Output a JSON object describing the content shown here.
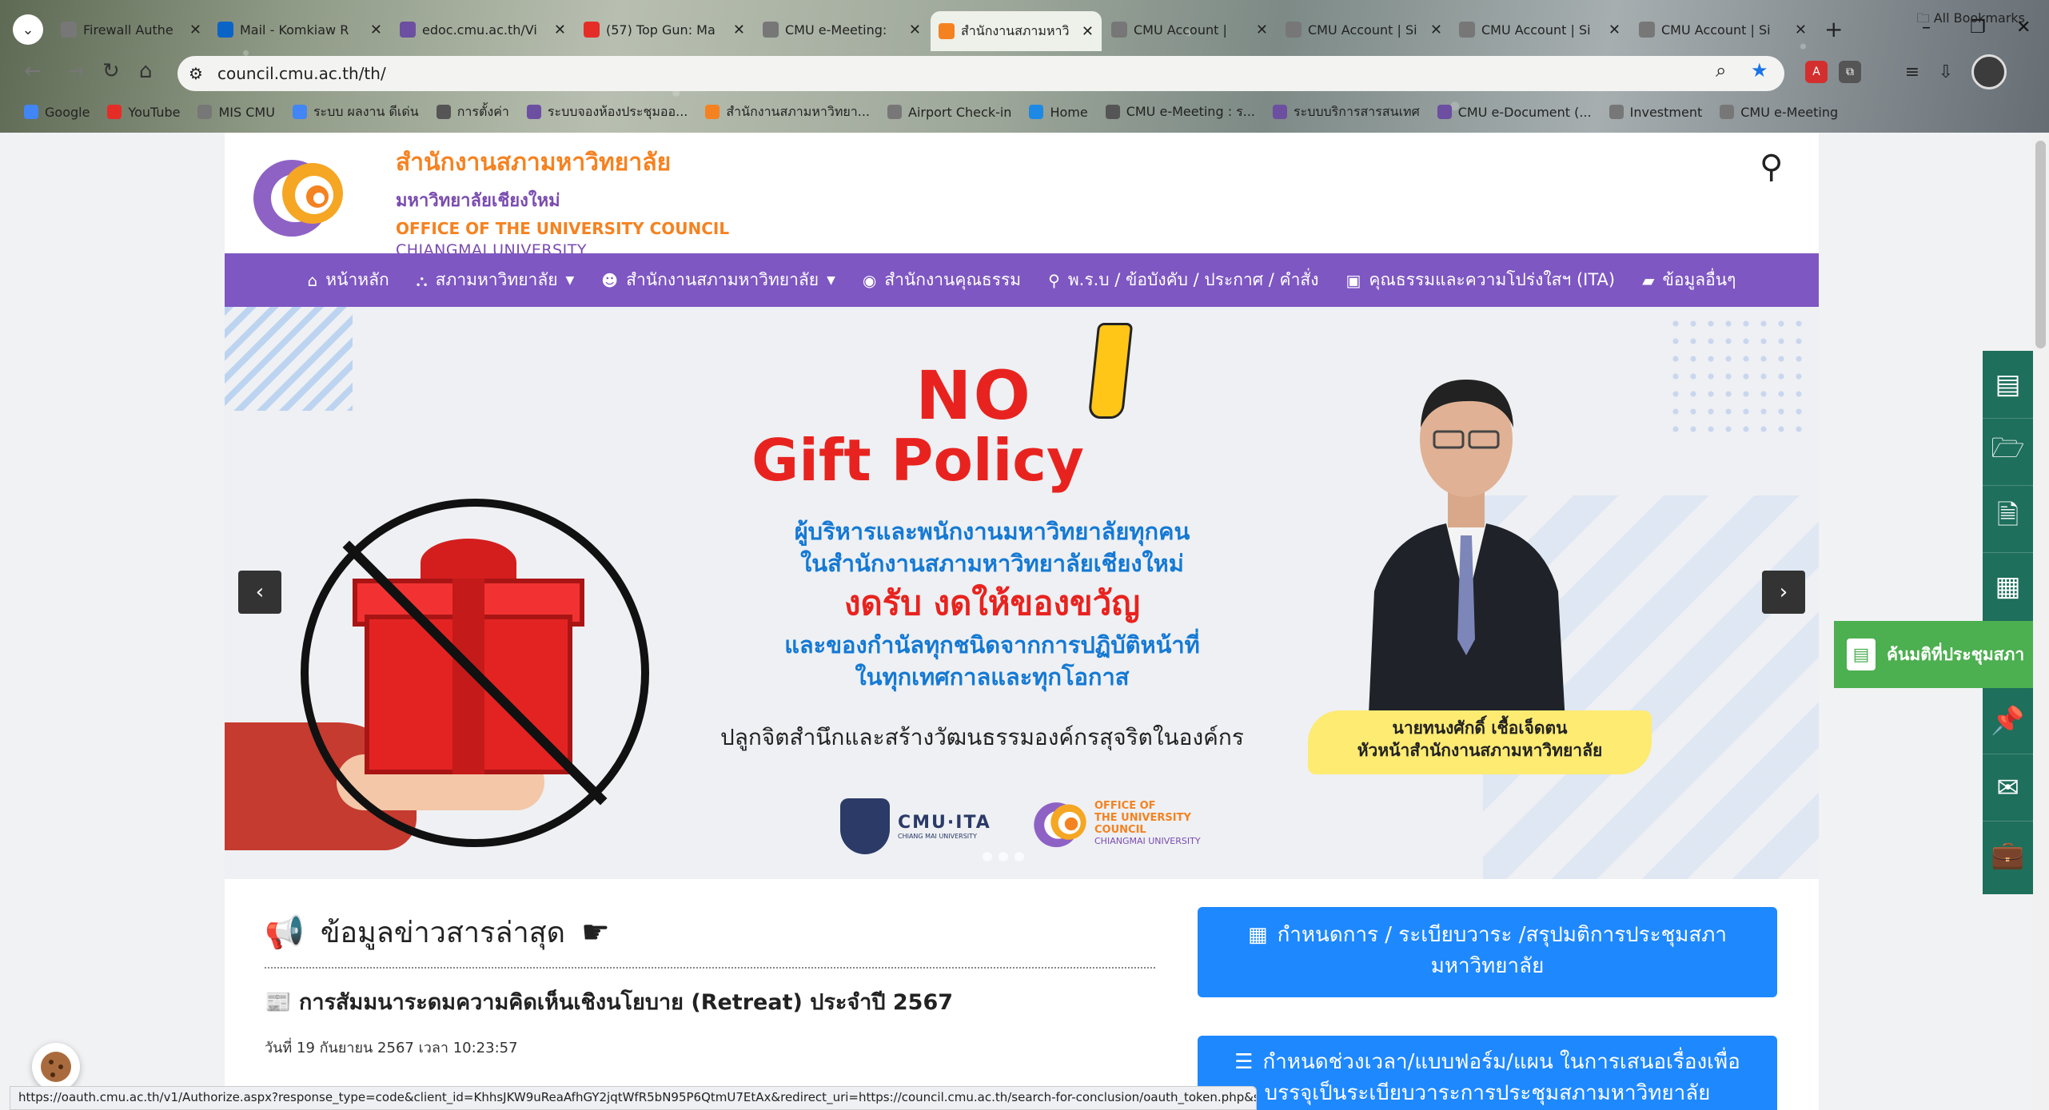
{
  "browser": {
    "tabs": [
      {
        "title": "Firewall Authe",
        "icon": "globe-icon",
        "color": "#777777"
      },
      {
        "title": "Mail - Komkiaw R",
        "icon": "outlook-icon",
        "color": "#0a64c8"
      },
      {
        "title": "edoc.cmu.ac.th/Vi",
        "icon": "cmu-icon",
        "color": "#6c4fa0"
      },
      {
        "title": "(57) Top Gun: Ma",
        "icon": "youtube-icon",
        "color": "#e52d27"
      },
      {
        "title": "CMU e-Meeting:",
        "icon": "globe-icon",
        "color": "#777777"
      },
      {
        "title": "สำนักงานสภามหาวิ",
        "icon": "council-icon",
        "color": "#f58220"
      },
      {
        "title": "CMU Account |",
        "icon": "globe-icon",
        "color": "#777777"
      },
      {
        "title": "CMU Account | Si",
        "icon": "globe-icon",
        "color": "#777777"
      },
      {
        "title": "CMU Account | Si",
        "icon": "globe-icon",
        "color": "#777777"
      },
      {
        "title": "CMU Account | Si",
        "icon": "globe-icon",
        "color": "#777777"
      }
    ],
    "url": "council.cmu.ac.th/th/",
    "bookmarks": [
      {
        "label": "Google",
        "color": "#4285f4"
      },
      {
        "label": "YouTube",
        "color": "#e52d27"
      },
      {
        "label": "MIS CMU",
        "color": "#777777"
      },
      {
        "label": "ระบบ ผลงาน ดีเด่น",
        "color": "#4285f4"
      },
      {
        "label": "การตั้งค่า",
        "color": "#555555"
      },
      {
        "label": "ระบบจองห้องประชุมออ...",
        "color": "#6c4fa0"
      },
      {
        "label": "สำนักงานสภามหาวิทยา...",
        "color": "#f58220"
      },
      {
        "label": "Airport Check-in",
        "color": "#777777"
      },
      {
        "label": "Home",
        "color": "#1e88e5"
      },
      {
        "label": "CMU e-Meeting : ร...",
        "color": "#555555"
      },
      {
        "label": "ระบบบริการสารสนเทศ",
        "color": "#6c4fa0"
      },
      {
        "label": "CMU e-Document (...",
        "color": "#6c4fa0"
      },
      {
        "label": "Investment",
        "color": "#777777"
      },
      {
        "label": "CMU e-Meeting",
        "color": "#777777"
      }
    ],
    "all_bookmarks": "All Bookmarks"
  },
  "site": {
    "org_th": "สำนักงานสภามหาวิทยาลัย",
    "univ_th": "มหาวิทยาลัยเชียงใหม่",
    "org_en": "OFFICE OF THE UNIVERSITY COUNCIL",
    "univ_en": "CHIANGMAI UNIVERSITY",
    "nav": [
      {
        "label": "หน้าหลัก",
        "icon": "home-icon",
        "dropdown": false
      },
      {
        "label": "สภามหาวิทยาลัย",
        "icon": "sitemap-icon",
        "dropdown": true
      },
      {
        "label": "สำนักงานสภามหาวิทยาลัย",
        "icon": "face-icon",
        "dropdown": true
      },
      {
        "label": "สำนักงานคุณธรรม",
        "icon": "eye-icon",
        "dropdown": false
      },
      {
        "label": "พ.ร.บ / ข้อบังคับ / ประกาศ / คำสั่ง",
        "icon": "thumbtack-icon",
        "dropdown": false
      },
      {
        "label": "คุณธรรมและความโปร่งใสฯ (ITA)",
        "icon": "monitor-icon",
        "dropdown": false
      },
      {
        "label": "ข้อมูลอื่นๆ",
        "icon": "folder-icon",
        "dropdown": false
      }
    ]
  },
  "banner": {
    "no": "NO",
    "gift_policy": "Gift Policy",
    "line1": "ผู้บริหารและพนักงานมหาวิทยาลัยทุกคน",
    "line2": "ในสำนักงานสภามหาวิทยาลัยเชียงใหม่",
    "line3": "งดรับ งดให้ของขวัญ",
    "line4": "และของกำนัลทุกชนิดจากการปฏิบัติหน้าที่",
    "line5": "ในทุกเทศกาลและทุกโอกาส",
    "footer": "ปลูกจิตสำนึกและสร้างวัฒนธรรมองค์กรสุจริตในองค์กร",
    "person_name": "นายทนงศักดิ์ เชื้อเจ็ดตน",
    "person_title": "หัวหน้าสำนักงานสภามหาวิทยาลัย",
    "ita_logo": "CMU·ITA",
    "ita_sub": "CHIANG MAI UNIVERSITY",
    "oc_logo_1": "OFFICE OF",
    "oc_logo_2": "THE UNIVERSITY",
    "oc_logo_3": "COUNCIL",
    "oc_logo_4": "CHIANGMAI UNIVERSITY"
  },
  "news": {
    "heading": "ข้อมูลข่าวสารล่าสุด",
    "item_title": "การสัมมนาระดมความคิดเห็นเชิงนโยบาย (Retreat) ประจำปี 2567",
    "item_date": "วันที่ 19 กันยายน 2567 เวลา 10:23:57"
  },
  "buttons": {
    "agenda": "กำหนดการ / ระเบียบวาระ /สรุปมติการประชุมสภามหาวิทยาลัย",
    "proposal": "กำหนดช่วงเวลา/แบบฟอร์ม/แผน ในการเสนอเรื่องเพื่อบรรจุเป็นระเบียบวาระการประชุมสภามหาวิทยาลัย"
  },
  "side": {
    "meeting_search": "ค้นมติที่ประชุมสภา"
  },
  "status_url": "https://oauth.cmu.ac.th/v1/Authorize.aspx?response_type=code&client_id=KhhsJKW9uReaAfhGY2jqtWfR5bN95P6QtmU7EtAx&redirect_uri=https://council.cmu.ac.th/search-for-conclusion/oauth_token.php&scope=basic",
  "colors": {
    "nav_purple": "#7e57c2",
    "brand_orange": "#f58220",
    "brand_purple": "#7a4bb0",
    "action_blue": "#1e88ff",
    "side_green": "#1e6f5c",
    "popup_green": "#4caf50",
    "policy_red": "#e8231f"
  }
}
